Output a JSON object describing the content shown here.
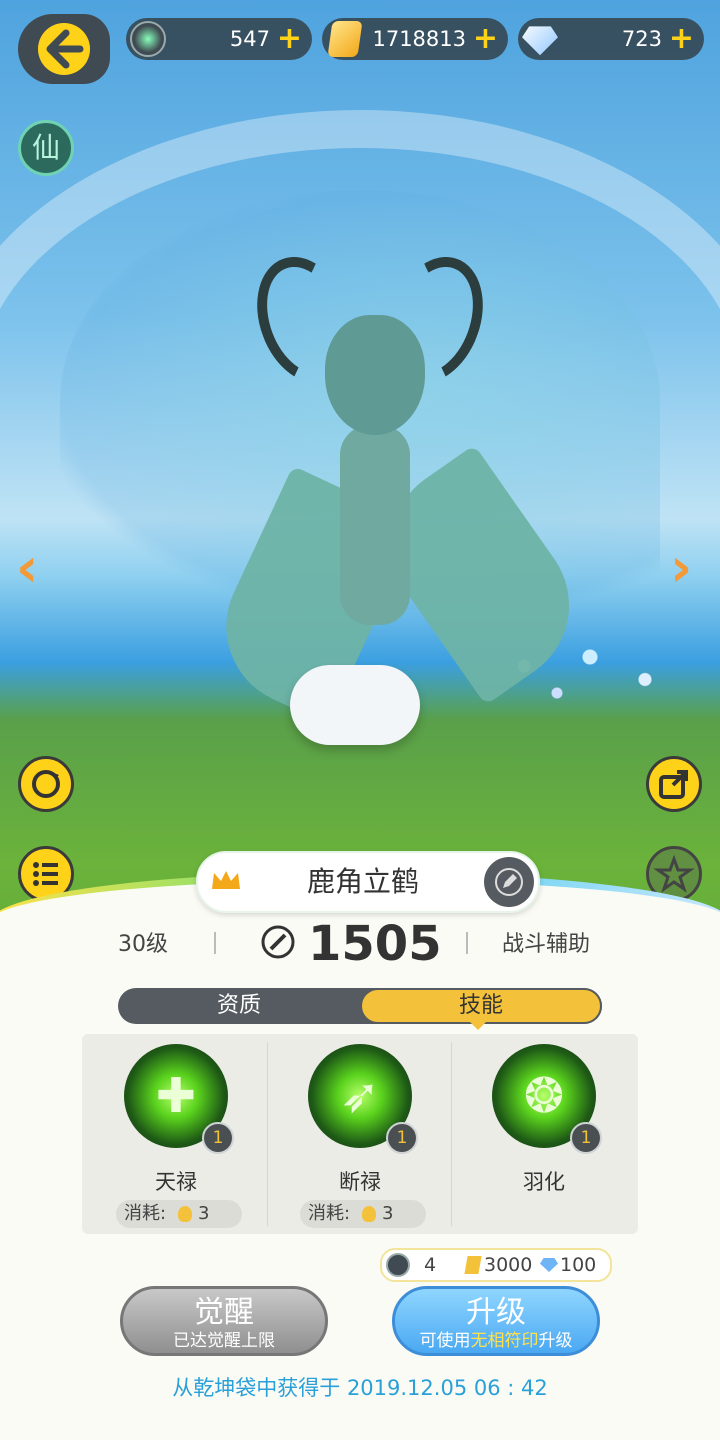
{
  "resources": [
    {
      "name": "spirit-coin",
      "value": "547",
      "icon": "teal-orb-icon",
      "color": "#3f4a52"
    },
    {
      "name": "gold",
      "value": "1718813",
      "icon": "gold-crystal-icon",
      "color": "#f3c23a"
    },
    {
      "name": "diamond",
      "value": "723",
      "icon": "diamond-icon",
      "color": "#6fb4f5"
    }
  ],
  "top": {
    "plus": "+",
    "xian_label": "仙"
  },
  "nav": {
    "prev": "‹",
    "next": "›"
  },
  "pet": {
    "name": "鹿角立鹤",
    "level": "30级",
    "power": "1505",
    "role": "战斗辅助"
  },
  "tabs": [
    {
      "label": "资质"
    },
    {
      "label": "技能"
    }
  ],
  "active_tab": "技能",
  "skills": [
    {
      "name": "天禄",
      "level": "1",
      "cost_label": "消耗:",
      "cost": "3",
      "glyph": "✚"
    },
    {
      "name": "断禄",
      "level": "1",
      "cost_label": "消耗:",
      "cost": "3",
      "glyph": "➶"
    },
    {
      "name": "羽化",
      "level": "1",
      "glyph": "❂"
    }
  ],
  "upgrade_cost": {
    "coin": "4",
    "gold": "3000",
    "diamond": "100"
  },
  "buttons": {
    "awaken": {
      "title": "觉醒",
      "sub": "已达觉醒上限"
    },
    "upgrade": {
      "title": "升级",
      "sub_pre": "可使用",
      "sub_hl": "无相符印",
      "sub_post": "升级"
    }
  },
  "obtained": "从乾坤袋中获得于 2019.12.05   06 : 42",
  "colors": {
    "accent": "#f3c23a",
    "link": "#2aa0d8",
    "upgrade": "#4aa8f2"
  }
}
